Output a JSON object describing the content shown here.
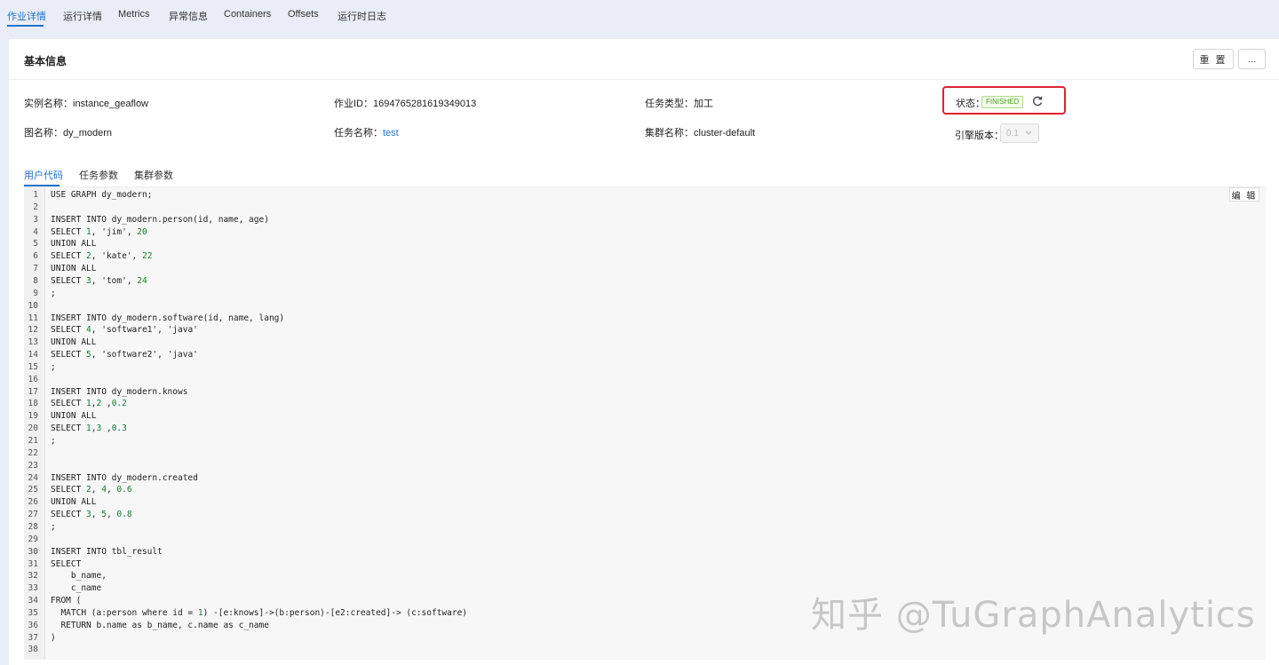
{
  "top_tabs": [
    {
      "label": "作业详情",
      "active": true
    },
    {
      "label": "运行详情"
    },
    {
      "label": "Metrics"
    },
    {
      "label": "异常信息"
    },
    {
      "label": "Containers"
    },
    {
      "label": "Offsets"
    },
    {
      "label": "运行时日志"
    }
  ],
  "basic_info": {
    "title": "基本信息",
    "reset_label": "重 置",
    "more_label": "..."
  },
  "fields": {
    "instance_name_label": "实例名称：",
    "instance_name": "instance_geaflow",
    "job_id_label": "作业ID：",
    "job_id": "1694765281619349013",
    "task_type_label": "任务类型：",
    "task_type": "加工",
    "graph_name_label": "图名称：",
    "graph_name": "dy_modern",
    "task_name_label": "任务名称：",
    "task_name": "test",
    "cluster_name_label": "集群名称：",
    "cluster_name": "cluster-default"
  },
  "status": {
    "label": "状态：",
    "value": "FINISHED",
    "color": "#4da52b",
    "highlight_color": "#dd2233",
    "refresh_icon": "refresh-icon"
  },
  "engine": {
    "label": "引擎版本：",
    "value": "0.1"
  },
  "sub_tabs": [
    {
      "label": "用户代码",
      "active": true
    },
    {
      "label": "任务参数"
    },
    {
      "label": "集群参数"
    }
  ],
  "editor": {
    "edit_label": "编 辑",
    "lines": [
      "USE GRAPH dy_modern;",
      "",
      "INSERT INTO dy_modern.person(id, name, age)",
      "SELECT 1, 'jim', 20",
      "UNION ALL",
      "SELECT 2, 'kate', 22",
      "UNION ALL",
      "SELECT 3, 'tom', 24",
      ";",
      "",
      "INSERT INTO dy_modern.software(id, name, lang)",
      "SELECT 4, 'software1', 'java'",
      "UNION ALL",
      "SELECT 5, 'software2', 'java'",
      ";",
      "",
      "INSERT INTO dy_modern.knows",
      "SELECT 1,2 ,0.2",
      "UNION ALL",
      "SELECT 1,3 ,0.3",
      ";",
      "",
      "",
      "INSERT INTO dy_modern.created",
      "SELECT 2, 4, 0.6",
      "UNION ALL",
      "SELECT 3, 5, 0.8",
      ";",
      "",
      "INSERT INTO tbl_result",
      "SELECT",
      "    b_name,",
      "    c_name",
      "FROM (",
      "  MATCH (a:person where id = 1) -[e:knows]->(b:person)-[e2:created]-> (c:software)",
      "  RETURN b.name as b_name, c.name as c_name",
      ")",
      ""
    ]
  },
  "watermark": "知乎 @TuGraphAnalytics"
}
